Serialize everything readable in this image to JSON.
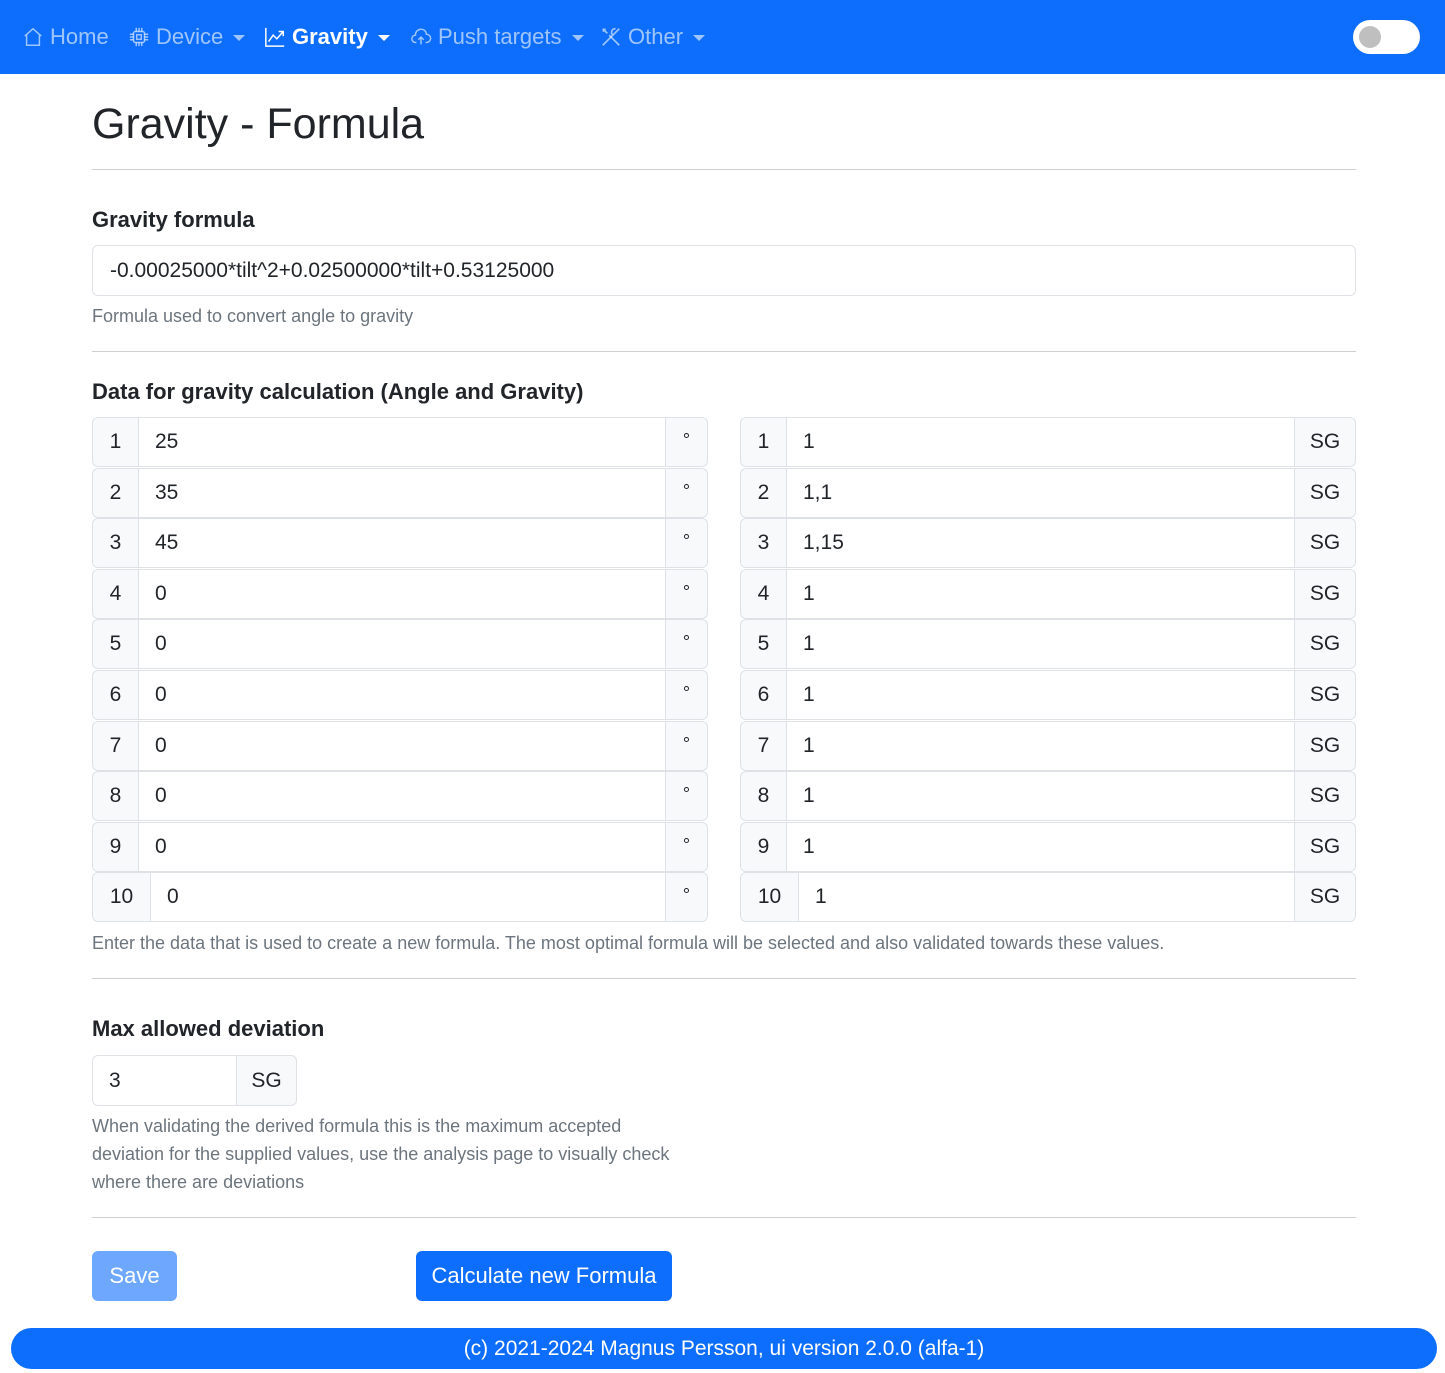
{
  "nav": {
    "home": "Home",
    "device": "Device",
    "gravity": "Gravity",
    "push_targets": "Push targets",
    "other": "Other"
  },
  "page_title": "Gravity - Formula",
  "formula": {
    "label": "Gravity formula",
    "value": "-0.00025000*tilt^2+0.02500000*tilt+0.53125000",
    "help": "Formula used to convert angle to gravity"
  },
  "data_section": {
    "label": "Data for gravity calculation (Angle and Gravity)",
    "angle_unit": "°",
    "gravity_unit": "SG",
    "rows": [
      {
        "index": "1",
        "angle": "25",
        "gravity": "1"
      },
      {
        "index": "2",
        "angle": "35",
        "gravity": "1,1"
      },
      {
        "index": "3",
        "angle": "45",
        "gravity": "1,15"
      },
      {
        "index": "4",
        "angle": "0",
        "gravity": "1"
      },
      {
        "index": "5",
        "angle": "0",
        "gravity": "1"
      },
      {
        "index": "6",
        "angle": "0",
        "gravity": "1"
      },
      {
        "index": "7",
        "angle": "0",
        "gravity": "1"
      },
      {
        "index": "8",
        "angle": "0",
        "gravity": "1"
      },
      {
        "index": "9",
        "angle": "0",
        "gravity": "1"
      },
      {
        "index": "10",
        "angle": "0",
        "gravity": "1"
      }
    ],
    "help": "Enter the data that is used to create a new formula. The most optimal formula will be selected and also validated towards these values."
  },
  "deviation": {
    "label": "Max allowed deviation",
    "value": "3",
    "unit": "SG",
    "help_lines": [
      "When validating the derived formula this is the maximum accepted",
      "deviation for the supplied values, use the analysis page to visually check",
      "where there are deviations"
    ]
  },
  "buttons": {
    "save": "Save",
    "calculate": "Calculate new Formula"
  },
  "footer": "(c) 2021-2024 Magnus Persson, ui version 2.0.0 (alfa-1)",
  "colors": {
    "primary": "#0d6efd",
    "primary_disabled": "#6ea8fe",
    "muted_text": "#6c757d",
    "addon_bg": "#f8f9fa"
  }
}
